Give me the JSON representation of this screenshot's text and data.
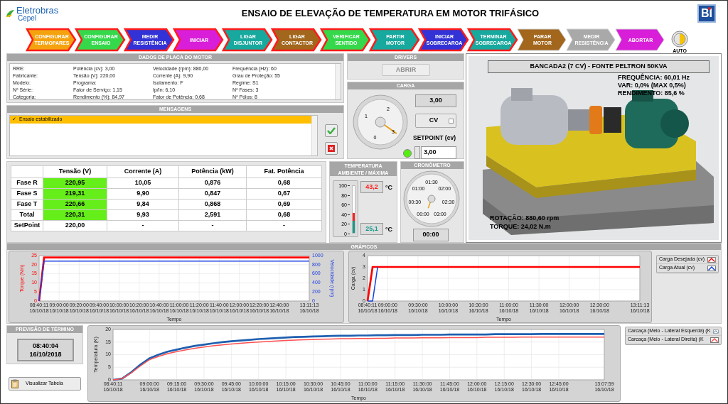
{
  "header": {
    "org": "Eletrobras",
    "org_sub": "Cepel",
    "title": "ENSAIO DE ELEVAÇÃO DE TEMPERATURA EM MOTOR TRIFÁSICO",
    "badge": "BI"
  },
  "steps": [
    {
      "label": "CONFIGURAR\nTERMOPARES",
      "color": "#f5a20f",
      "done": true
    },
    {
      "label": "CONFIGURAR\nENSAIO",
      "color": "#34d84a",
      "done": true
    },
    {
      "label": "MEDIR\nRESISTÊNCIA",
      "color": "#3232d6",
      "done": true
    },
    {
      "label": "INICIAR",
      "color": "#d81ed8",
      "done": true
    },
    {
      "label": "LIGAR\nDISJUNTOR",
      "color": "#17a89e",
      "done": true
    },
    {
      "label": "LIGAR\nCONTACTOR",
      "color": "#a2661c",
      "done": true
    },
    {
      "label": "VERIFICAR\nSENTIDO",
      "color": "#34d84a",
      "done": true
    },
    {
      "label": "PARTIR\nMOTOR",
      "color": "#17a89e",
      "done": true
    },
    {
      "label": "INICIAR\nSOBRECARGA",
      "color": "#3232d6",
      "done": true
    },
    {
      "label": "TERMINAR\nSOBRECARGA",
      "color": "#17a89e",
      "done": true
    },
    {
      "label": "PARAR\nMOTOR",
      "color": "#a2661c",
      "done": false
    },
    {
      "label": "MEDIR\nRESISTÊNCIA",
      "color": "#a9a9a9",
      "done": false
    },
    {
      "label": "ABORTAR",
      "color": "#d81ed8",
      "done": false
    }
  ],
  "auto": {
    "label": "AUTO",
    "on": true
  },
  "nameplate": {
    "title": "DADOS DE PLACA DO MOTOR",
    "rows": [
      [
        "RRE:",
        "Potência (cv): 3,00",
        "Velocidade (rpm): 880,00",
        "Frequência (Hz): 60"
      ],
      [
        "Fabricante:",
        "Tensão (V): 220,00",
        "Corrente (A): 9,90",
        "Grau de Proteção: 55"
      ],
      [
        "Modelo:",
        "Programa:",
        "Isolamento: F",
        "Regime: S1"
      ],
      [
        "Nº Série:",
        "Fator de Serviço: 1,15",
        "Ip/In: 6,10",
        "Nº Fases: 3"
      ],
      [
        "Categoria:",
        "Rendimento (%): 84,97",
        "Fator de Potência: 0,68",
        "Nº Pólos: 8"
      ]
    ]
  },
  "messages": {
    "title": "MENSAGENS",
    "items": [
      {
        "mark": "✓",
        "text": "Ensaio estabilizado",
        "selected": true
      }
    ]
  },
  "drivers": {
    "title": "DRIVERS",
    "button": "ABRIR",
    "disabled": true
  },
  "load": {
    "title": "CARGA",
    "gauge": {
      "labels": [
        "0",
        "1",
        "2",
        "3"
      ]
    },
    "reading": "3,00",
    "unit": "CV",
    "setpoint_label": "SETPOINT (cv)",
    "setpoint": "3,00",
    "indicator_on": true
  },
  "measurements": {
    "columns": [
      "",
      "Tensão (V)",
      "Corrente (A)",
      "Potência (kW)",
      "Fat. Potência"
    ],
    "rows": [
      {
        "cells": [
          "Fase R",
          "220,95",
          "10,05",
          "0,876",
          "0,68"
        ],
        "ok": true
      },
      {
        "cells": [
          "Fase S",
          "219,31",
          "9,90",
          "0,847",
          "0,67"
        ],
        "ok": true
      },
      {
        "cells": [
          "Fase T",
          "220,66",
          "9,84",
          "0,868",
          "0,69"
        ],
        "ok": true
      },
      {
        "cells": [
          "Total",
          "220,31",
          "9,93",
          "2,591",
          "0,68"
        ],
        "ok": true
      },
      {
        "cells": [
          "SetPoint",
          "220,00",
          "-",
          "-",
          "-"
        ],
        "ok": false
      }
    ]
  },
  "temperature": {
    "title": "TEMPERATURA AMBIENTE / MÁXIMA",
    "scale": [
      "100",
      "80",
      "60",
      "40",
      "20",
      "0"
    ],
    "thermometer": {
      "max": {
        "level": 0.432
      },
      "ambient": {
        "level": 0.251
      }
    },
    "readings": [
      {
        "value": "43,2",
        "unit": "°C",
        "color": "#ff2020"
      },
      {
        "value": "25,1",
        "unit": "°C",
        "color": "#17998a"
      }
    ]
  },
  "stopwatch": {
    "title": "CRONÔMETRO",
    "dial_labels": [
      "00:00",
      "00:30",
      "01:00",
      "01:30",
      "02:00",
      "02:30",
      "03:00"
    ],
    "reading": "00:00"
  },
  "bench": {
    "title": "BANCADA2 (7 CV) - FONTE PELTRON 50KVA",
    "top_readings": [
      "FREQUÊNCIA: 60,01 Hz",
      "VAR: 0,0% (MAX 0,5%)",
      "RENDIMENTO: 85,6 %"
    ],
    "bottom_readings": [
      "ROTAÇÃO: 880,60 rpm",
      "TORQUE: 24,02 N.m"
    ]
  },
  "charts_title": "GRÁFICOS",
  "torque_chart": {
    "chart_data": {
      "type": "line",
      "grid": true,
      "xlabel": "Tempo",
      "ylabel": "Torque (Nm)",
      "y2label": "Velocidade (rpm)",
      "categories": [
        "08:40:11\n16/10/18",
        null,
        null,
        null,
        "09:00:00\n16/10/18",
        null,
        null,
        null,
        "09:20:00\n16/10/18",
        null,
        null,
        null,
        "09:40:00\n16/10/18",
        null,
        null,
        null,
        "10:00:00\n16/10/18",
        null,
        null,
        null,
        "10:20:00\n16/10/18",
        null,
        null,
        null,
        "10:40:00\n16/10/18",
        null,
        null,
        null,
        "11:00:00\n16/10/18",
        null,
        null,
        null,
        "11:20:00\n16/10/18",
        null,
        null,
        null,
        "11:40:00\n16/10/18",
        null,
        null,
        null,
        "12:00:00\n16/10/18",
        null,
        null,
        null,
        "12:20:00\n16/10/18",
        null,
        null,
        null,
        "12:40:00\n16/10/18",
        null,
        null,
        null,
        null,
        null,
        "13:11:13\n16/10/18"
      ],
      "ylim": [
        0,
        25
      ],
      "y2lim": [
        0,
        1000
      ],
      "yticks": [
        0,
        5,
        10,
        15,
        20,
        25
      ],
      "y2ticks": [
        0,
        200,
        400,
        600,
        800,
        1000
      ],
      "series": [
        {
          "color": "#ff0000",
          "values": [
            0,
            24,
            24,
            24,
            24,
            24,
            24,
            24,
            24,
            24,
            24,
            24,
            24,
            24,
            24,
            24,
            24,
            24,
            24,
            24,
            24,
            24,
            24,
            24,
            24,
            24,
            24,
            24,
            24,
            24,
            24,
            24,
            24,
            24,
            24,
            24,
            24,
            24,
            24,
            24,
            24,
            24,
            24,
            24,
            24,
            24,
            24,
            24,
            24,
            24,
            24,
            24,
            24,
            24,
            24
          ]
        },
        {
          "color": "#2040e0",
          "axis": "y2",
          "values": [
            0,
            880,
            880,
            880,
            880,
            880,
            880,
            880,
            880,
            880,
            880,
            880,
            880,
            880,
            880,
            880,
            880,
            880,
            880,
            880,
            880,
            880,
            880,
            880,
            880,
            880,
            880,
            880,
            880,
            880,
            880,
            880,
            880,
            880,
            880,
            880,
            880,
            880,
            880,
            880,
            880,
            880,
            880,
            880,
            880,
            880,
            880,
            880,
            880,
            880,
            880,
            880,
            880,
            880,
            880
          ]
        }
      ]
    }
  },
  "load_chart": {
    "chart_data": {
      "type": "line",
      "grid": true,
      "xlabel": "Tempo",
      "ylabel": "Carga (cv)",
      "categories": [
        "08:40:11\n16/10/18",
        null,
        null,
        null,
        "09:00:00\n16/10/18",
        null,
        null,
        null,
        null,
        null,
        "09:30:00\n16/10/18",
        null,
        null,
        null,
        null,
        null,
        "10:00:00\n16/10/18",
        null,
        null,
        null,
        null,
        null,
        "10:30:00\n16/10/18",
        null,
        null,
        null,
        null,
        null,
        "11:00:00\n16/10/18",
        null,
        null,
        null,
        null,
        null,
        "11:30:00\n16/10/18",
        null,
        null,
        null,
        null,
        null,
        "12:00:00\n16/10/18",
        null,
        null,
        null,
        null,
        null,
        "12:30:00\n16/10/18",
        null,
        null,
        null,
        null,
        null,
        null,
        null,
        "13:11:13\n16/10/18"
      ],
      "ylim": [
        0,
        4
      ],
      "yticks": [
        0,
        1,
        2,
        3,
        4
      ],
      "series": [
        {
          "name": "Carga Desejada (cv)",
          "color": "#ff0000",
          "values": [
            0,
            3,
            3,
            3,
            3,
            3,
            3,
            3,
            3,
            3,
            3,
            3,
            3,
            3,
            3,
            3,
            3,
            3,
            3,
            3,
            3,
            3,
            3,
            3,
            3,
            3,
            3,
            3,
            3,
            3,
            3,
            3,
            3,
            3,
            3,
            3,
            3,
            3,
            3,
            3,
            3,
            3,
            3,
            3,
            3,
            3,
            3,
            3,
            3,
            3,
            3,
            3,
            3,
            3,
            3
          ]
        },
        {
          "name": "Carga Atual (cv)",
          "color": "#1040e0",
          "values": [
            0,
            0,
            3,
            null,
            null,
            null,
            null,
            null,
            null,
            null,
            null,
            null,
            null,
            null,
            null,
            null,
            null,
            null,
            null,
            null,
            null,
            null,
            null,
            null,
            null,
            null,
            null,
            null,
            null,
            null,
            null,
            null,
            null,
            null,
            null,
            null,
            null,
            null,
            null,
            null,
            null,
            null,
            null,
            null,
            null,
            null,
            null,
            null,
            null,
            null,
            null,
            null,
            null,
            null,
            null
          ]
        }
      ]
    }
  },
  "forecast": {
    "title": "PREVISÃO DE TÉRMINO",
    "time": "08:40:04",
    "date": "16/10/2018",
    "button": "Visualizar Tabela"
  },
  "temperature_chart": {
    "chart_data": {
      "type": "line",
      "grid": true,
      "xlabel": "Tempo",
      "ylabel": "Temperatura (K)",
      "categories": [
        "08:40:11\n16/10/18",
        null,
        null,
        null,
        "09:00:00\n16/10/18",
        null,
        null,
        "09:15:00\n16/10/18",
        null,
        null,
        "09:30:00\n16/10/18",
        null,
        null,
        "09:45:00\n16/10/18",
        null,
        null,
        "10:00:00\n16/10/18",
        null,
        null,
        "10:15:00\n16/10/18",
        null,
        null,
        "10:30:00\n16/10/18",
        null,
        null,
        "10:45:00\n16/10/18",
        null,
        null,
        "11:00:00\n16/10/18",
        null,
        null,
        "11:15:00\n16/10/18",
        null,
        null,
        "11:30:00\n16/10/18",
        null,
        null,
        "11:45:00\n16/10/18",
        null,
        null,
        "12:00:00\n16/10/18",
        null,
        null,
        "12:15:00\n16/10/18",
        null,
        null,
        "12:30:00\n16/10/18",
        null,
        null,
        "12:45:00\n16/10/18",
        null,
        null,
        null,
        null,
        "13:07:59\n16/10/18"
      ],
      "ylim": [
        0,
        20
      ],
      "yticks": [
        0,
        5,
        10,
        15,
        20
      ],
      "series": [
        {
          "name": "Carcaça (Meio - Lateral Esquerda) (K",
          "color": "#1f5fb0",
          "values": [
            0,
            0.5,
            3,
            6,
            8.5,
            10,
            11.2,
            12,
            12.8,
            13.5,
            14,
            14.5,
            15,
            15.3,
            15.6,
            15.9,
            16.2,
            16.4,
            16.6,
            16.8,
            17,
            17.1,
            17.2,
            17.3,
            17.4,
            17.5,
            17.5,
            17.6,
            17.6,
            17.7,
            17.7,
            17.8,
            17.8,
            17.8,
            17.9,
            17.9,
            17.9,
            18,
            18,
            18,
            18,
            18,
            18.1,
            18.1,
            18.1,
            18.1,
            18.1,
            18.2,
            18.2,
            18.2,
            18.2,
            18.2,
            18.2,
            18.2,
            18.2
          ]
        },
        {
          "name": "Carcaça (Meio - Lateral Direita) (K",
          "color": "#ff5050",
          "values": [
            0,
            0.5,
            2.8,
            5.5,
            8,
            9.3,
            10.4,
            11.2,
            11.9,
            12.5,
            13,
            13.5,
            13.9,
            14.2,
            14.5,
            14.8,
            15,
            15.2,
            15.4,
            15.6,
            15.8,
            15.9,
            16,
            16.1,
            16.2,
            16.3,
            16.3,
            16.4,
            16.4,
            16.5,
            16.5,
            16.6,
            16.6,
            16.6,
            16.7,
            16.7,
            16.7,
            16.8,
            16.8,
            16.8,
            16.8,
            16.9,
            16.9,
            16.9,
            16.9,
            17,
            17,
            17,
            17,
            17,
            17,
            17,
            17,
            17,
            17
          ]
        }
      ]
    }
  }
}
